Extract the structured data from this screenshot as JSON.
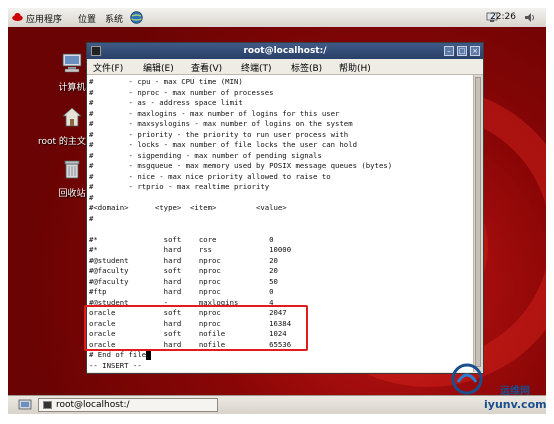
{
  "top_panel": {
    "menu_applications": "应用程序",
    "menu_places": "位置",
    "menu_system": "系统",
    "clock": "22:26"
  },
  "desktop_icons": [
    {
      "label": "计算机"
    },
    {
      "label": "root 的主文件夹"
    },
    {
      "label": "回收站"
    }
  ],
  "window": {
    "title": "root@localhost:/",
    "menu": [
      "文件(F)",
      "编辑(E)",
      "查看(V)",
      "终端(T)",
      "标签(B)",
      "帮助(H)"
    ]
  },
  "terminal_lines": [
    "#        - cpu - max CPU time (MIN)",
    "#        - nproc - max number of processes",
    "#        - as - address space limit",
    "#        - maxlogins - max number of logins for this user",
    "#        - maxsyslogins - max number of logins on the system",
    "#        - priority - the priority to run user process with",
    "#        - locks - max number of file locks the user can hold",
    "#        - sigpending - max number of pending signals",
    "#        - msgqueue - max memory used by POSIX message queues (bytes)",
    "#        - nice - max nice priority allowed to raise to",
    "#        - rtprio - max realtime priority",
    "#",
    "#<domain>      <type>  <item>         <value>",
    "#",
    "",
    "#*               soft    core            0",
    "#*               hard    rss             10000",
    "#@student        hard    nproc           20",
    "#@faculty        soft    nproc           20",
    "#@faculty        hard    nproc           50",
    "#ftp             hard    nproc           0",
    "#@student        -       maxlogins       4",
    "oracle           soft    nproc           2047",
    "oracle           hard    nproc           16384",
    "oracle           soft    nofile          1024",
    "oracle           hard    nofile          65536",
    "# End of file",
    "-- INSERT --"
  ],
  "taskbar": {
    "task_label": "root@localhost:/"
  },
  "watermark": {
    "text": "iyunv.com",
    "text2": "运维网"
  },
  "colors": {
    "desktop_red": "#b01010",
    "title_blue": "#2a4068",
    "highlight_box": "#e21b1b"
  }
}
